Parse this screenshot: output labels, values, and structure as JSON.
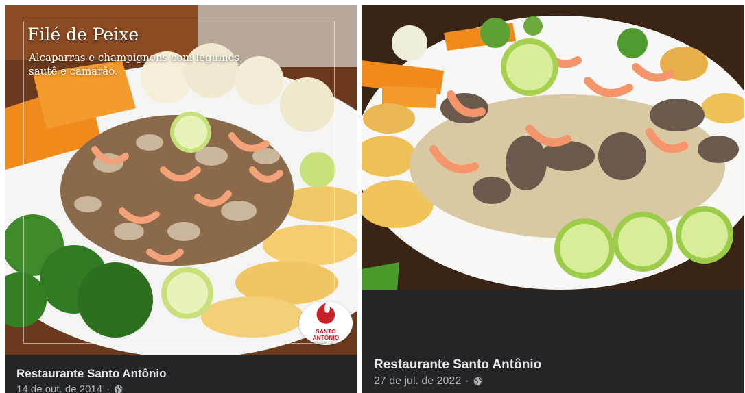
{
  "posts": [
    {
      "photo_title": "Filé de Peixe",
      "photo_subtitle": "Alcaparras e champignons com legumes, sautê e camarão.",
      "logo_line1": "SANTO",
      "logo_line2": "ANTÔNIO",
      "logo_since": "Desde 1955",
      "page_name": "Restaurante Santo Antônio",
      "date": "14 de out. de 2014",
      "separator": "·",
      "privacy_icon": "globe-icon"
    },
    {
      "page_name": "Restaurante Santo Antônio",
      "date": "27 de jul. de 2022",
      "separator": "·",
      "privacy_icon": "globe-icon"
    }
  ],
  "colors": {
    "card_bg": "#242526",
    "name_text": "#e4e6eb",
    "meta_text": "#b0b3b8",
    "brand_red": "#c62028"
  }
}
